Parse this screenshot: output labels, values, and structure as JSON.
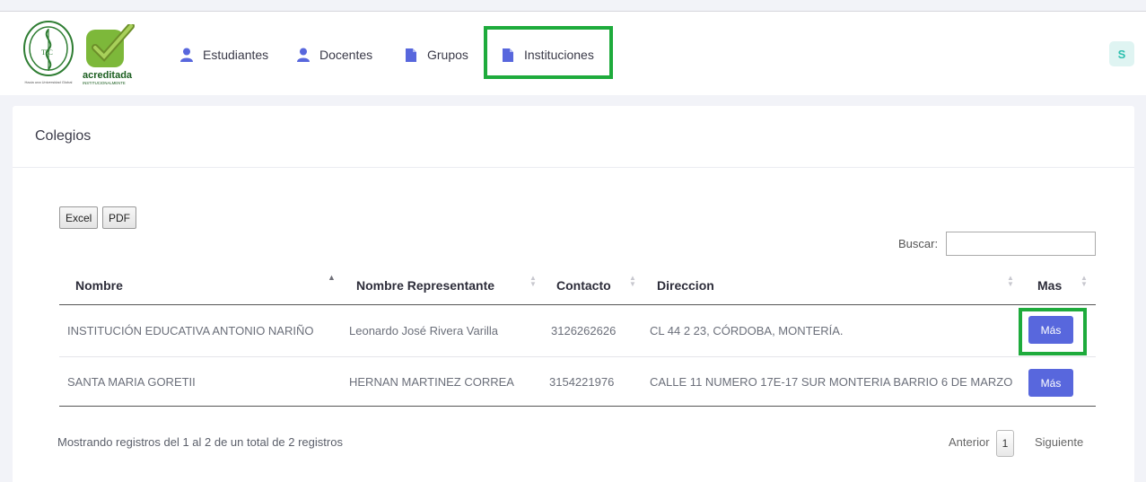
{
  "nav": {
    "items": [
      {
        "label": "Estudiantes",
        "icon": "user-icon"
      },
      {
        "label": "Docentes",
        "icon": "user-icon"
      },
      {
        "label": "Grupos",
        "icon": "file-icon"
      },
      {
        "label": "Instituciones",
        "icon": "file-icon"
      }
    ],
    "icon_color": "#5867dd",
    "highlight_color": "#1eab3c"
  },
  "logos": {
    "seal_caption": "Hacia una Universidad Global",
    "acred_word": "acreditada",
    "acred_sub": "INSTITUCIONALMENTE"
  },
  "user": {
    "initial": "S"
  },
  "card": {
    "title": "Colegios"
  },
  "export": {
    "excel_label": "Excel",
    "pdf_label": "PDF"
  },
  "search": {
    "label": "Buscar:",
    "value": ""
  },
  "table": {
    "headers": [
      "Nombre",
      "Nombre Representante",
      "Contacto",
      "Direccion",
      "Mas"
    ],
    "rows": [
      {
        "nombre": "INSTITUCIÓN EDUCATIVA ANTONIO NARIÑO",
        "representante": "Leonardo José Rivera Varilla",
        "contacto": "3126262626",
        "direccion": "CL 44 2 23, CÓRDOBA, MONTERÍA.",
        "action": "Más"
      },
      {
        "nombre": "SANTA MARIA GORETII",
        "representante": "HERNAN MARTINEZ CORREA",
        "contacto": "3154221976",
        "direccion": "CALLE 11 NUMERO 17E-17 SUR MONTERIA BARRIO 6 DE MARZO",
        "action": "Más"
      }
    ]
  },
  "footer": {
    "info": "Mostrando registros del 1 al 2 de un total de 2 registros",
    "prev": "Anterior",
    "page": "1",
    "next": "Siguiente"
  },
  "colors": {
    "primary_button": "#5867dd",
    "avatar_bg": "#dff4f2",
    "avatar_fg": "#2bbfae"
  }
}
